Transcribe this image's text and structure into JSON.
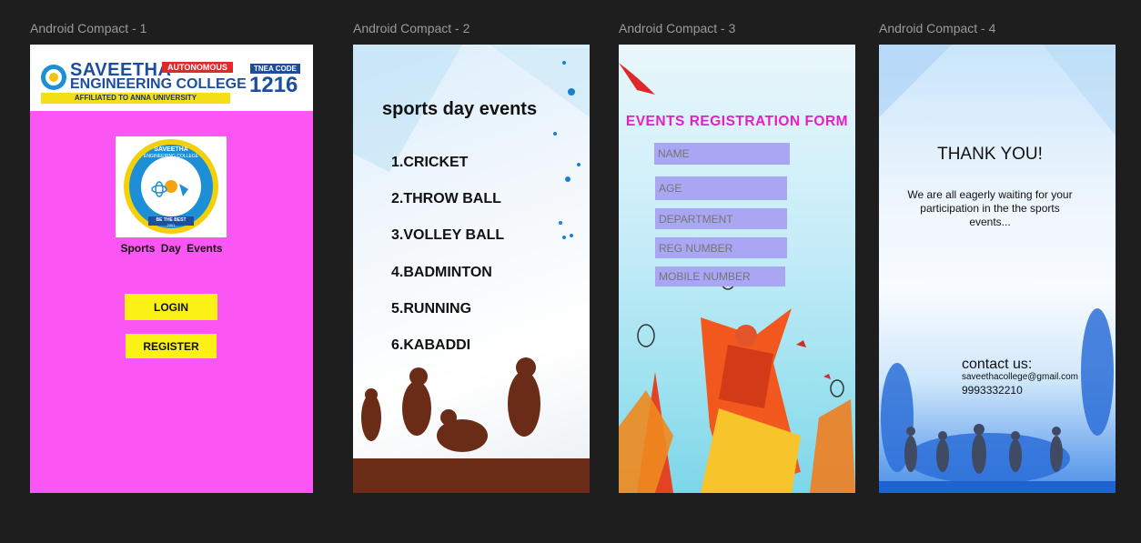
{
  "frames": [
    {
      "label": "Android Compact - 1"
    },
    {
      "label": "Android Compact - 2"
    },
    {
      "label": "Android Compact - 3"
    },
    {
      "label": "Android Compact - 4"
    }
  ],
  "colors": {
    "canvas": "#1e1e1e",
    "frame1_bg": "#fb56f4",
    "button_yellow": "#fcf116",
    "form_title": "#e41ec9",
    "field_bg": "#a9a6f4",
    "college_blue": "#1d4e9e"
  },
  "home": {
    "college_name_line1": "SAVEETHA",
    "college_name_line2": "ENGINEERING COLLEGE",
    "autonomous_badge": "AUTONOMOUS",
    "affiliation": "AFFILIATED TO ANNA UNIVERSITY",
    "tnea_label": "TNEA CODE",
    "tnea_code": "1216",
    "emblem_top": "SAVEETHA",
    "emblem_sub": "ENGINEERING COLLEGE",
    "emblem_motto": "BE THE BEST",
    "emblem_year": "2001",
    "title": "Sports Day Events",
    "login_label": "LOGIN",
    "register_label": "REGISTER"
  },
  "events": {
    "title": "sports day events",
    "items": [
      "1.CRICKET",
      "2.THROW BALL",
      "3.VOLLEY BALL",
      "4.BADMINTON",
      "5.RUNNING",
      "6.KABADDI"
    ]
  },
  "registration": {
    "title": "EVENTS REGISTRATION FORM",
    "fields": [
      "NAME",
      "AGE",
      "DEPARTMENT",
      "REG NUMBER",
      "MOBILE NUMBER"
    ]
  },
  "thanks": {
    "heading": "THANK YOU!",
    "message": "We are all eagerly waiting for your participation in the the sports events...",
    "contact_heading": "contact us:",
    "email": "saveethacollege@gmail.com",
    "phone": "9993332210"
  }
}
